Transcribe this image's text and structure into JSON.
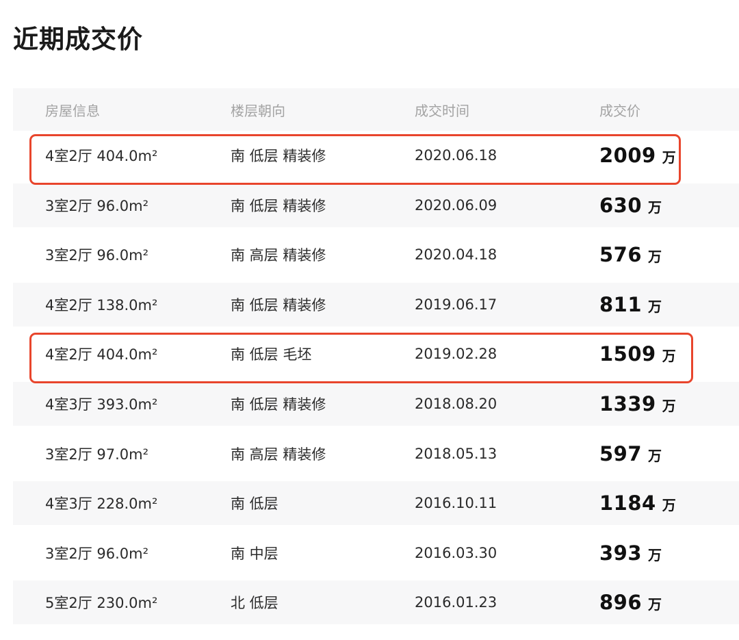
{
  "title": "近期成交价",
  "headers": [
    "房屋信息",
    "楼层朝向",
    "成交时间",
    "成交价"
  ],
  "rows": [
    {
      "info": "4室2厅 404.0m²",
      "floor": "南 低层 精装修",
      "date": "2020.06.18",
      "price": "2009",
      "unit": "万",
      "highlighted": true
    },
    {
      "info": "3室2厅 96.0m²",
      "floor": "南 低层 精装修",
      "date": "2020.06.09",
      "price": "630",
      "unit": "万",
      "highlighted": false
    },
    {
      "info": "3室2厅 96.0m²",
      "floor": "南 高层 精装修",
      "date": "2020.04.18",
      "price": "576",
      "unit": "万",
      "highlighted": false
    },
    {
      "info": "4室2厅 138.0m²",
      "floor": "南 低层 精装修",
      "date": "2019.06.17",
      "price": "811",
      "unit": "万",
      "highlighted": false
    },
    {
      "info": "4室2厅 404.0m²",
      "floor": "南 低层 毛坯",
      "date": "2019.02.28",
      "price": "1509",
      "unit": "万",
      "highlighted": true
    },
    {
      "info": "4室3厅 393.0m²",
      "floor": "南 低层 精装修",
      "date": "2018.08.20",
      "price": "1339",
      "unit": "万",
      "highlighted": false
    },
    {
      "info": "3室2厅 97.0m²",
      "floor": "南 高层 精装修",
      "date": "2018.05.13",
      "price": "597",
      "unit": "万",
      "highlighted": false
    },
    {
      "info": "4室3厅 228.0m²",
      "floor": "南 低层",
      "date": "2016.10.11",
      "price": "1184",
      "unit": "万",
      "highlighted": false
    },
    {
      "info": "3室2厅 96.0m²",
      "floor": "南 中层",
      "date": "2016.03.30",
      "price": "393",
      "unit": "万",
      "highlighted": false
    },
    {
      "info": "5室2厅 230.0m²",
      "floor": "北 低层",
      "date": "2016.01.23",
      "price": "896",
      "unit": "万",
      "highlighted": false
    }
  ],
  "colors": {
    "highlight_border": "#e8452c",
    "header_text": "#a3a3a3",
    "row_shade": "#f7f7f8"
  }
}
